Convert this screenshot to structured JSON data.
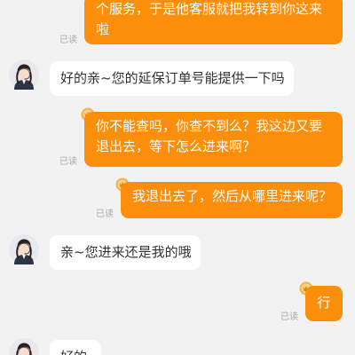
{
  "messages": [
    {
      "from": "me",
      "lines": [
        "个服务，于是他客服就把我转到你这来",
        "啦"
      ],
      "status": "已读"
    },
    {
      "from": "agent",
      "lines": [
        "好的亲~您的延保订单号能提供一下吗"
      ]
    },
    {
      "from": "me",
      "lines": [
        "你不能查吗，你查不到么？我这边又要",
        "退出去，等下怎么进来啊？"
      ],
      "status": "已读"
    },
    {
      "from": "me",
      "lines": [
        "我退出去了，然后从哪里进来呢？"
      ],
      "status": "已读"
    },
    {
      "from": "agent",
      "lines": [
        "亲~您进来还是我的哦"
      ]
    },
    {
      "from": "me",
      "lines": [
        "行"
      ],
      "status": "已读"
    },
    {
      "from": "agent",
      "lines": [
        "好的"
      ]
    }
  ],
  "colors": {
    "background": "#f2f2f2",
    "my_bubble": "#fb8e0b",
    "agent_bubble": "#ffffff",
    "read_receipt": "#a8a8a8"
  },
  "icons": {
    "agent_avatar": "customer-service-avatar-icon",
    "my_badge": "vip-badge-icon"
  }
}
